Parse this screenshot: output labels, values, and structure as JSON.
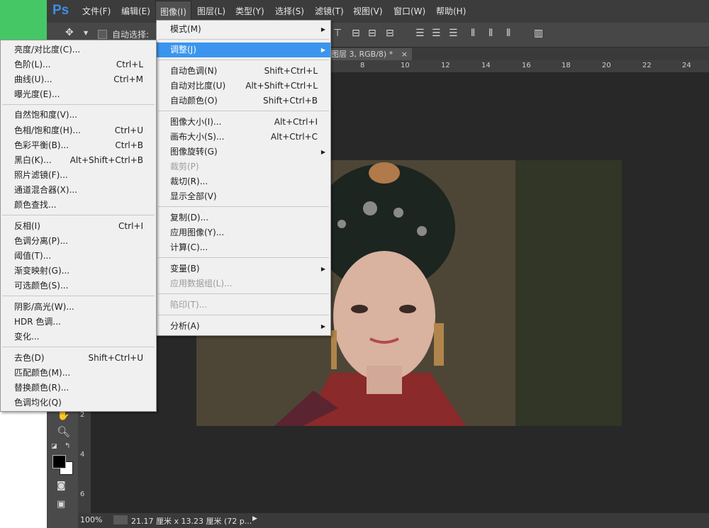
{
  "app": {
    "logo": "Ps"
  },
  "menubar": [
    "文件(F)",
    "编辑(E)",
    "图像(I)",
    "图层(L)",
    "类型(Y)",
    "选择(S)",
    "滤镜(T)",
    "视图(V)",
    "窗口(W)",
    "帮助(H)"
  ],
  "options": {
    "auto_select_label": "自动选择:"
  },
  "document_tab": {
    "label": "图层 3, RGB/8) *",
    "close": "×"
  },
  "ruler_numbers": [
    "8",
    "10",
    "12",
    "14",
    "16",
    "18",
    "20",
    "22",
    "24"
  ],
  "ruler_left_numbers": [
    "2",
    "4",
    "6"
  ],
  "status": {
    "zoom": "100%",
    "doc_info": "21.17 厘米 x 13.23 厘米 (72 p..."
  },
  "image_menu": {
    "items": [
      {
        "label": "模式(M)",
        "shortcut": "",
        "arrow": "▶"
      },
      {
        "label": "调整(J)",
        "shortcut": "",
        "arrow": "▶"
      },
      {
        "label": "自动色调(N)",
        "shortcut": "Shift+Ctrl+L"
      },
      {
        "label": "自动对比度(U)",
        "shortcut": "Alt+Shift+Ctrl+L"
      },
      {
        "label": "自动颜色(O)",
        "shortcut": "Shift+Ctrl+B"
      },
      {
        "label": "图像大小(I)...",
        "shortcut": "Alt+Ctrl+I"
      },
      {
        "label": "画布大小(S)...",
        "shortcut": "Alt+Ctrl+C"
      },
      {
        "label": "图像旋转(G)",
        "shortcut": "",
        "arrow": "▶"
      },
      {
        "label": "裁剪(P)",
        "shortcut": ""
      },
      {
        "label": "裁切(R)...",
        "shortcut": ""
      },
      {
        "label": "显示全部(V)",
        "shortcut": ""
      },
      {
        "label": "复制(D)...",
        "shortcut": ""
      },
      {
        "label": "应用图像(Y)...",
        "shortcut": ""
      },
      {
        "label": "计算(C)...",
        "shortcut": ""
      },
      {
        "label": "变量(B)",
        "shortcut": "",
        "arrow": "▶"
      },
      {
        "label": "应用数据组(L)...",
        "shortcut": ""
      },
      {
        "label": "陷印(T)...",
        "shortcut": ""
      },
      {
        "label": "分析(A)",
        "shortcut": "",
        "arrow": "▶"
      }
    ]
  },
  "adjust_menu": {
    "items": [
      {
        "label": "亮度/对比度(C)...",
        "shortcut": ""
      },
      {
        "label": "色阶(L)...",
        "shortcut": "Ctrl+L"
      },
      {
        "label": "曲线(U)...",
        "shortcut": "Ctrl+M"
      },
      {
        "label": "曝光度(E)...",
        "shortcut": ""
      },
      {
        "label": "自然饱和度(V)...",
        "shortcut": ""
      },
      {
        "label": "色相/饱和度(H)...",
        "shortcut": "Ctrl+U"
      },
      {
        "label": "色彩平衡(B)...",
        "shortcut": "Ctrl+B"
      },
      {
        "label": "黑白(K)...",
        "shortcut": "Alt+Shift+Ctrl+B"
      },
      {
        "label": "照片滤镜(F)...",
        "shortcut": ""
      },
      {
        "label": "通道混合器(X)...",
        "shortcut": ""
      },
      {
        "label": "颜色查找...",
        "shortcut": ""
      },
      {
        "label": "反相(I)",
        "shortcut": "Ctrl+I"
      },
      {
        "label": "色调分离(P)...",
        "shortcut": ""
      },
      {
        "label": "阈值(T)...",
        "shortcut": ""
      },
      {
        "label": "渐变映射(G)...",
        "shortcut": ""
      },
      {
        "label": "可选颜色(S)...",
        "shortcut": ""
      },
      {
        "label": "阴影/高光(W)...",
        "shortcut": ""
      },
      {
        "label": "HDR 色调...",
        "shortcut": ""
      },
      {
        "label": "变化...",
        "shortcut": ""
      },
      {
        "label": "去色(D)",
        "shortcut": "Shift+Ctrl+U"
      },
      {
        "label": "匹配颜色(M)...",
        "shortcut": ""
      },
      {
        "label": "替换颜色(R)...",
        "shortcut": ""
      },
      {
        "label": "色调均化(Q)",
        "shortcut": ""
      }
    ]
  },
  "colors": {
    "highlight": "#3b95ee",
    "menubar": "#3c3c3c",
    "canvas": "#282828",
    "logo": "#3d8ee8"
  }
}
